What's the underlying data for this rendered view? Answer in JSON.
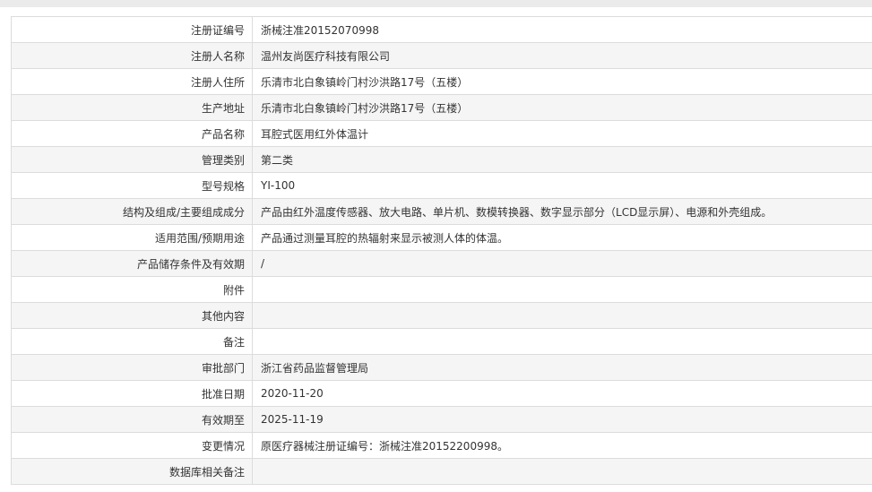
{
  "rows": [
    {
      "label": "注册证编号",
      "value": "浙械注准20152070998"
    },
    {
      "label": "注册人名称",
      "value": "温州友尚医疗科技有限公司"
    },
    {
      "label": "注册人住所",
      "value": "乐清市北白象镇岭门村沙洪路17号（五楼）"
    },
    {
      "label": "生产地址",
      "value": "乐清市北白象镇岭门村沙洪路17号（五楼）"
    },
    {
      "label": "产品名称",
      "value": "耳腔式医用红外体温计"
    },
    {
      "label": "管理类别",
      "value": "第二类"
    },
    {
      "label": "型号规格",
      "value": "YI-100"
    },
    {
      "label": "结构及组成/主要组成成分",
      "value": "产品由红外温度传感器、放大电路、单片机、数模转换器、数字显示部分（LCD显示屏）、电源和外壳组成。"
    },
    {
      "label": "适用范围/预期用途",
      "value": "产品通过测量耳腔的热辐射来显示被测人体的体温。"
    },
    {
      "label": "产品储存条件及有效期",
      "value": "/"
    },
    {
      "label": "附件",
      "value": ""
    },
    {
      "label": "其他内容",
      "value": ""
    },
    {
      "label": "备注",
      "value": ""
    },
    {
      "label": "审批部门",
      "value": "浙江省药品监督管理局"
    },
    {
      "label": "批准日期",
      "value": "2020-11-20"
    },
    {
      "label": "有效期至",
      "value": "2025-11-19"
    },
    {
      "label": "变更情况",
      "value": "原医疗器械注册证编号：浙械注准20152200998。"
    },
    {
      "label": "数据库相关备注",
      "value": ""
    }
  ]
}
